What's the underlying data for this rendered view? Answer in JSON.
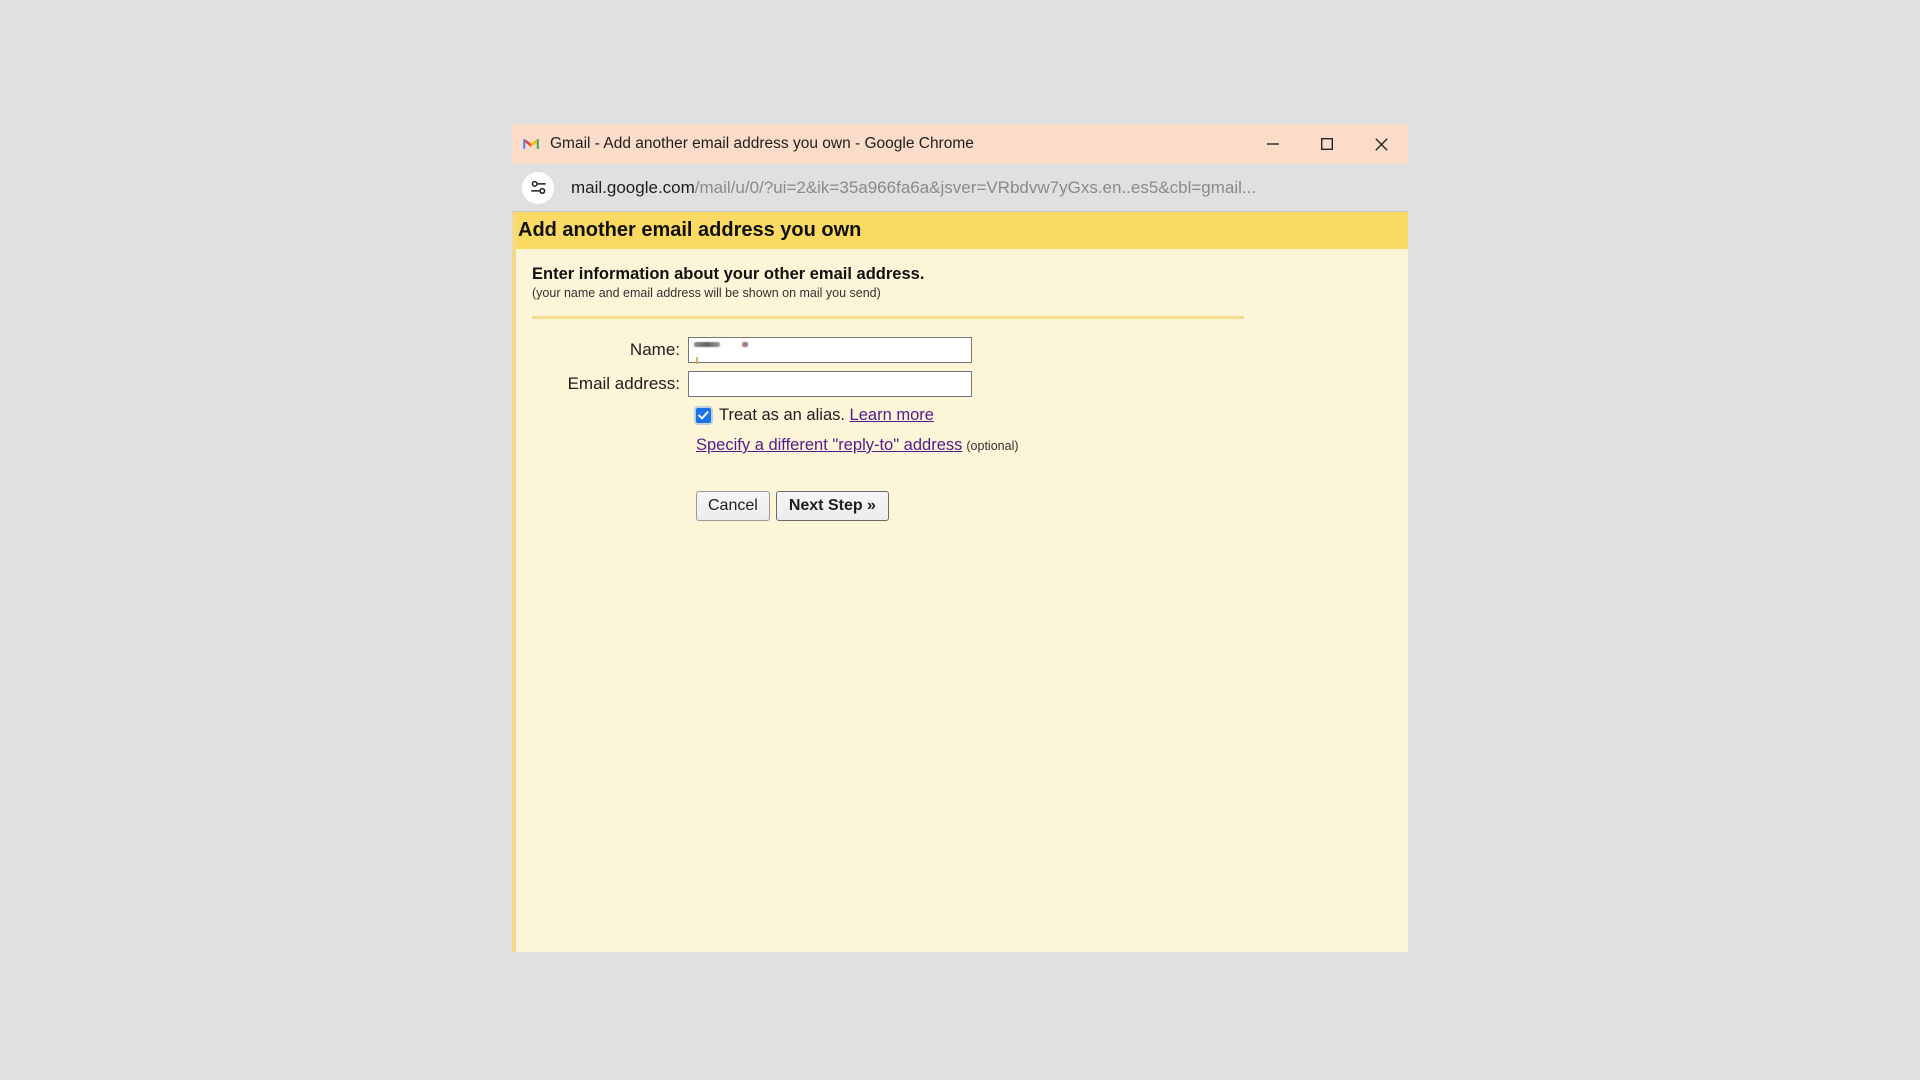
{
  "window": {
    "title": "Gmail - Add another email address you own - Google Chrome",
    "favicon_icon": "gmail-icon",
    "controls": [
      {
        "name": "minimize-button",
        "icon": "minimize-icon",
        "label": "—"
      },
      {
        "name": "maximize-button",
        "icon": "maximize-icon",
        "label": "❐"
      },
      {
        "name": "close-button",
        "icon": "close-icon",
        "label": "✕"
      }
    ]
  },
  "toolbar": {
    "site_info_icon": "site-settings-tune-icon",
    "url_host": "mail.google.com",
    "url_path": "/mail/u/0/?ui=2&ik=35a966fa6a&jsver=VRbdvw7yGxs.en..es5&cbl=gmail...",
    "url_full": "mail.google.com/mail/u/0/?ui=2&ik=35a966fa6a&jsver=VRbdvw7yGxs.en..es5&cbl=gmail..."
  },
  "page": {
    "banner_title": "Add another email address you own",
    "intro_heading": "Enter information about your other email address.",
    "intro_sub": "(your name and email address will be shown on mail you send)",
    "form": {
      "name_label": "Name:",
      "name_value": "",
      "name_placeholder": "",
      "email_label": "Email address:",
      "email_value": "",
      "email_placeholder": "",
      "alias_checkbox_checked": true,
      "alias_text": "Treat as an alias.",
      "alias_learn_more": "Learn more",
      "replyto_link": "Specify a different \"reply-to\" address",
      "replyto_optional": "(optional)"
    },
    "buttons": {
      "cancel": "Cancel",
      "next_step": "Next Step »"
    }
  },
  "colors": {
    "desktop_background": "#e0e0e0",
    "titlebar": "#fadcc8",
    "banner_yellow": "#fada63",
    "page_background": "#fdf5d8",
    "divider_gold": "#f5dc8f",
    "link_purple": "#551a8b",
    "checkbox_blue": "#1a73e8"
  }
}
